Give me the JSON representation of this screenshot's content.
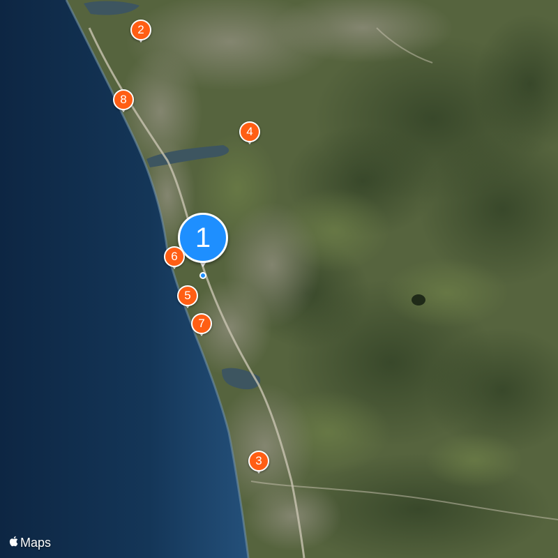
{
  "map": {
    "type": "satellite",
    "colors": {
      "ocean_deep": "#0f2a48",
      "ocean_mid": "#15375a",
      "ocean_shallow": "#24507a",
      "land": "#56643e",
      "land_dark": "#3a4a2c",
      "developed": "#8a8a78",
      "lagoon": "#3d5560",
      "highway": "#c9c4b2"
    }
  },
  "pins": [
    {
      "label": "1",
      "style": "large",
      "color": "#1e8fff"
    },
    {
      "label": "2",
      "style": "small",
      "color": "#ff5e14"
    },
    {
      "label": "3",
      "style": "small",
      "color": "#ff5e14"
    },
    {
      "label": "4",
      "style": "small",
      "color": "#ff5e14"
    },
    {
      "label": "5",
      "style": "small",
      "color": "#ff5e14"
    },
    {
      "label": "6",
      "style": "small",
      "color": "#ff5e14"
    },
    {
      "label": "7",
      "style": "small",
      "color": "#ff5e14"
    },
    {
      "label": "8",
      "style": "small",
      "color": "#ff5e14"
    }
  ],
  "attribution": {
    "logo": "apple-logo-icon",
    "text": "Maps"
  }
}
